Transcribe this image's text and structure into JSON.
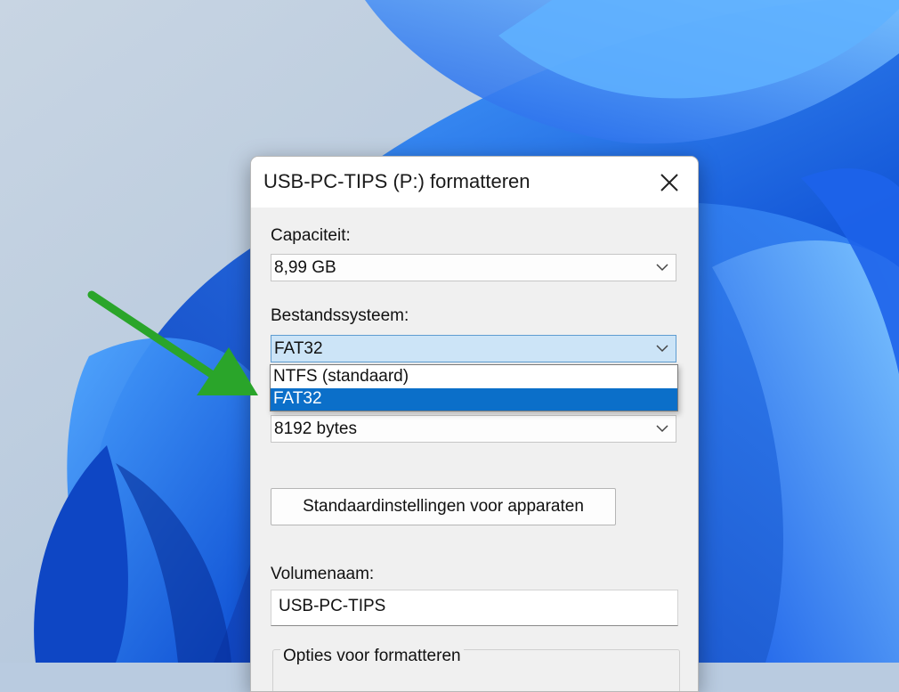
{
  "dialog": {
    "title": "USB-PC-TIPS (P:) formatteren",
    "close_icon": "close-icon"
  },
  "capacity": {
    "label": "Capaciteit:",
    "value": "8,99 GB"
  },
  "filesystem": {
    "label": "Bestandssysteem:",
    "value": "FAT32",
    "options": [
      "NTFS (standaard)",
      "FAT32"
    ],
    "selected_option": "FAT32"
  },
  "allocation_unit": {
    "value": "8192 bytes"
  },
  "restore_defaults_button": "Standaardinstellingen voor apparaten",
  "volume_label": {
    "label": "Volumenaam:",
    "value": "USB-PC-TIPS"
  },
  "format_options": {
    "label": "Opties voor formatteren"
  },
  "colors": {
    "selection": "#0b6fc9",
    "active_combo": "#cce4f7",
    "annotation_arrow": "#2aa52a"
  }
}
